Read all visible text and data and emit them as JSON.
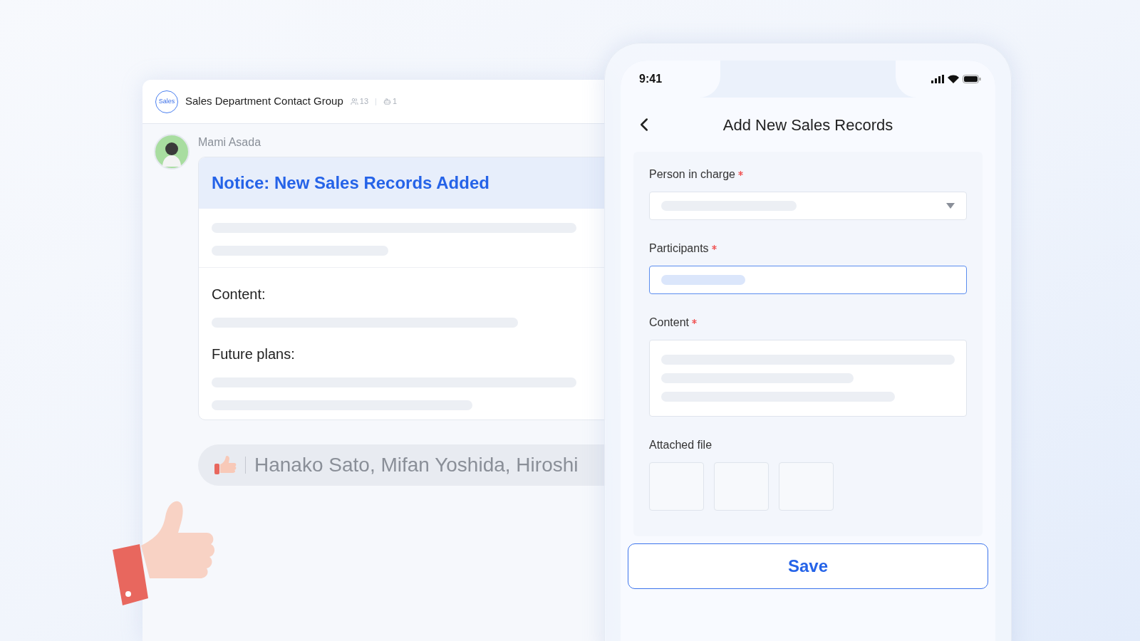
{
  "chat": {
    "group_badge": "Sales",
    "group_name": "Sales Department Contact Group",
    "member_count": "13",
    "bot_count": "1",
    "sender": "Mami Asada",
    "card": {
      "title": "Notice: New Sales Records Added",
      "sections": [
        {
          "heading": "Content:"
        },
        {
          "heading": "Future plans:"
        }
      ]
    },
    "reaction": {
      "names": "Hanako Sato, Mifan Yoshida, Hiroshi"
    }
  },
  "phone": {
    "time": "9:41",
    "title": "Add New Sales Records",
    "fields": [
      {
        "label": "Person in charge",
        "kind": "dropdown",
        "required": true,
        "focused": false
      },
      {
        "label": "Participants",
        "kind": "text",
        "required": true,
        "focused": true
      },
      {
        "label": "Content",
        "kind": "textarea",
        "required": true,
        "focused": false
      },
      {
        "label": "Attached file",
        "kind": "files",
        "required": false,
        "focused": false
      }
    ],
    "save_button": "Save"
  }
}
